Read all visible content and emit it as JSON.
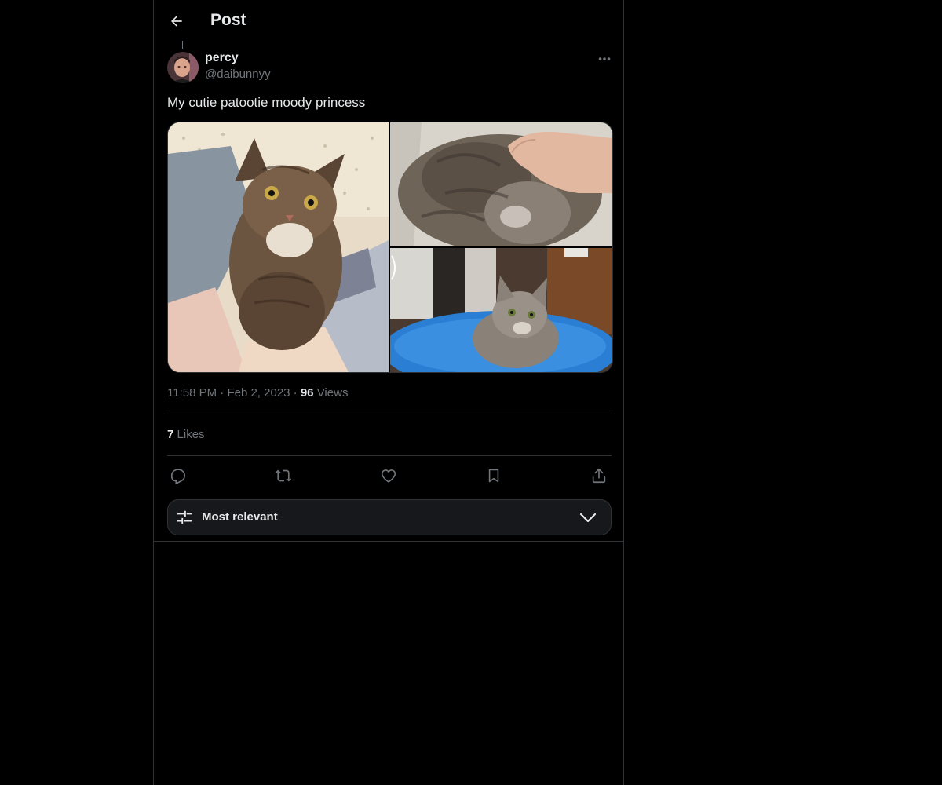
{
  "header": {
    "title": "Post",
    "back_icon": "arrow-left-icon"
  },
  "author": {
    "display_name": "percy",
    "handle": "@daibunnyy",
    "more_icon": "more-horizontal-icon"
  },
  "post": {
    "text": "My cutie patootie moody princess",
    "time": "11:58 PM",
    "separator": "·",
    "date": "Feb 2, 2023",
    "views_count": "96",
    "views_label": "Views",
    "likes_count": "7",
    "likes_label": "Likes"
  },
  "actions": [
    {
      "name": "reply",
      "icon": "reply-icon"
    },
    {
      "name": "repost",
      "icon": "repost-icon"
    },
    {
      "name": "like",
      "icon": "heart-icon"
    },
    {
      "name": "bookmark",
      "icon": "bookmark-icon"
    },
    {
      "name": "share",
      "icon": "share-icon"
    }
  ],
  "sort": {
    "label": "Most relevant",
    "icon": "sliders-icon",
    "chevron": "chevron-down-icon"
  },
  "colors": {
    "background": "#000000",
    "text": "#e7e9ea",
    "muted": "#71767b",
    "border": "#2f3336",
    "sort_bg": "#16181c"
  }
}
